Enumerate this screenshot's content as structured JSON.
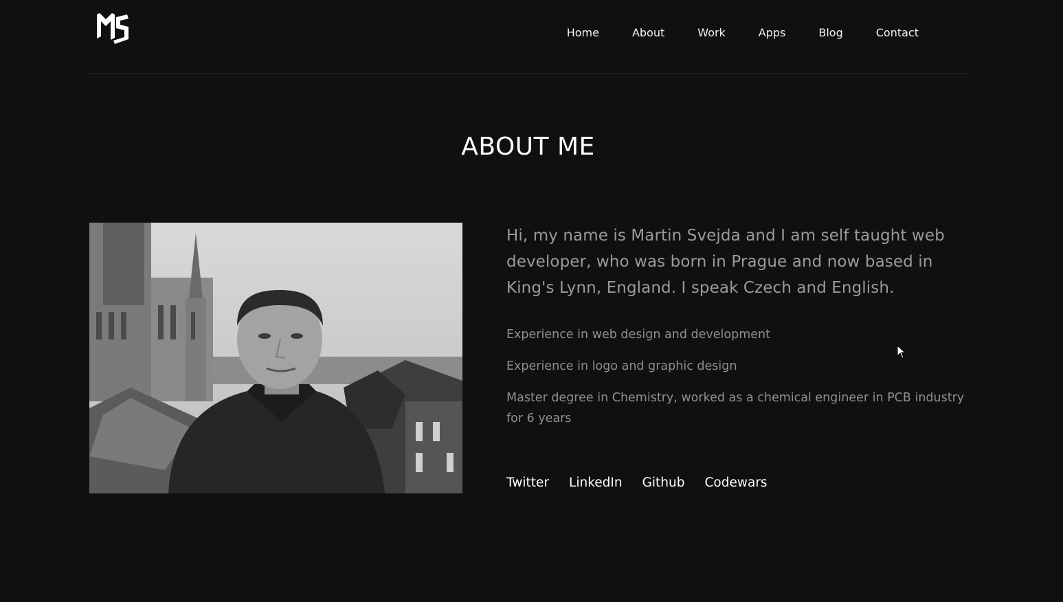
{
  "header": {
    "logo_alt": "MS",
    "nav": [
      {
        "label": "Home"
      },
      {
        "label": "About"
      },
      {
        "label": "Work"
      },
      {
        "label": "Apps"
      },
      {
        "label": "Blog"
      },
      {
        "label": "Contact"
      }
    ]
  },
  "main": {
    "title": "ABOUT ME",
    "photo_alt": "Martin Svejda",
    "intro": "Hi, my name is Martin Svejda and I am self taught web developer, who was born in Prague and now based in King's Lynn, England. I speak Czech and English.",
    "facts": [
      "Experience in web design and development",
      "Experience in logo and graphic design",
      "Master degree in Chemistry, worked as a chemical engineer in PCB industry for 6 years"
    ],
    "social": [
      {
        "label": "Twitter"
      },
      {
        "label": "LinkedIn"
      },
      {
        "label": "Github"
      },
      {
        "label": "Codewars"
      }
    ]
  },
  "colors": {
    "background": "#0f1111",
    "text_primary": "#ffffff",
    "text_muted": "#9a9a9a"
  }
}
